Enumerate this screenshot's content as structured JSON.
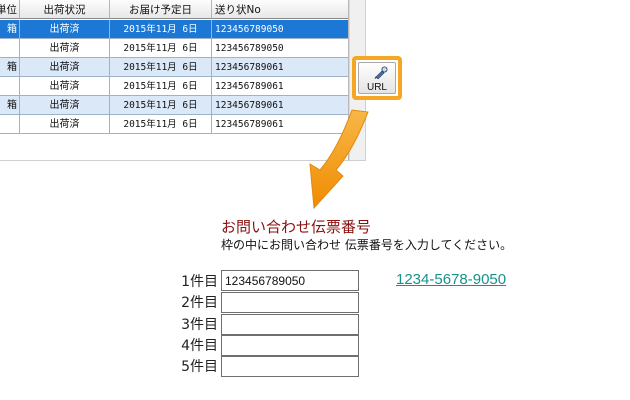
{
  "table": {
    "headers": [
      "単位",
      "出荷状況",
      "お届け予定日",
      "送り状No"
    ],
    "rows": [
      [
        "箱",
        "出荷済",
        "2015年11月 6日",
        "123456789050"
      ],
      [
        "",
        "出荷済",
        "2015年11月 6日",
        "123456789050"
      ],
      [
        "箱",
        "出荷済",
        "2015年11月 6日",
        "123456789061"
      ],
      [
        "",
        "出荷済",
        "2015年11月 6日",
        "123456789061"
      ],
      [
        "箱",
        "出荷済",
        "2015年11月 6日",
        "123456789061"
      ],
      [
        "",
        "出荷済",
        "2015年11月 6日",
        "123456789061"
      ]
    ],
    "selected_row": 0
  },
  "url_button": {
    "label": "URL",
    "icon": "link-pen-icon"
  },
  "colors": {
    "accent_orange": "#f5a623",
    "title_red": "#8b1010",
    "link_teal": "#17928a",
    "selection_blue": "#1c78d4"
  },
  "lookup": {
    "title": "お問い合わせ伝票番号",
    "instruction": "枠の中にお問い合わせ 伝票番号を入力してください。",
    "fields": [
      {
        "label": "1件目",
        "value": "123456789050"
      },
      {
        "label": "2件目",
        "value": ""
      },
      {
        "label": "3件目",
        "value": ""
      },
      {
        "label": "4件目",
        "value": ""
      },
      {
        "label": "5件目",
        "value": ""
      }
    ],
    "link_text": "1234-5678-9050"
  }
}
